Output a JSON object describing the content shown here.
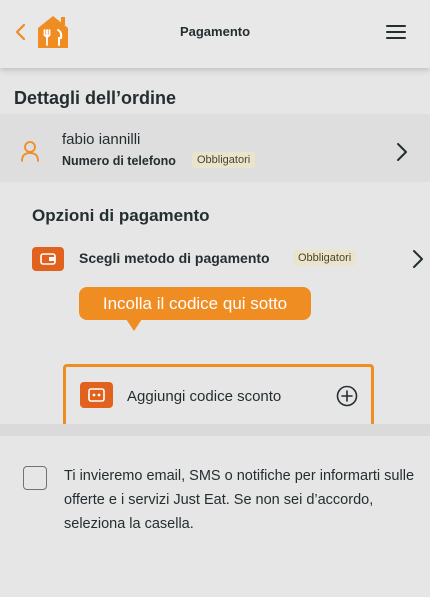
{
  "header": {
    "title": "Pagamento",
    "back_icon": "chevron-left-icon",
    "logo_icon": "house-fork-knife-logo",
    "menu_icon": "hamburger-menu-icon",
    "accent_color": "#ef8c22"
  },
  "order_details": {
    "title": "Dettagli dell’ordine",
    "contact": {
      "name": "fabio iannilli",
      "phone_label": "Numero di telefono",
      "badge": "Obbligatori"
    }
  },
  "payment_options": {
    "title": "Opzioni di pagamento",
    "method_label": "Scegli metodo di pagamento",
    "method_badge": "Obbligatori"
  },
  "tooltip": {
    "text": "Incolla il codice qui sotto"
  },
  "coupon": {
    "label": "Aggiungi codice sconto"
  },
  "consent": {
    "text": "Ti invieremo email, SMS o notifiche per informarti sulle offerte e i servizi Just Eat. Se non sei d’accordo, seleziona la casella.",
    "checked": false
  }
}
